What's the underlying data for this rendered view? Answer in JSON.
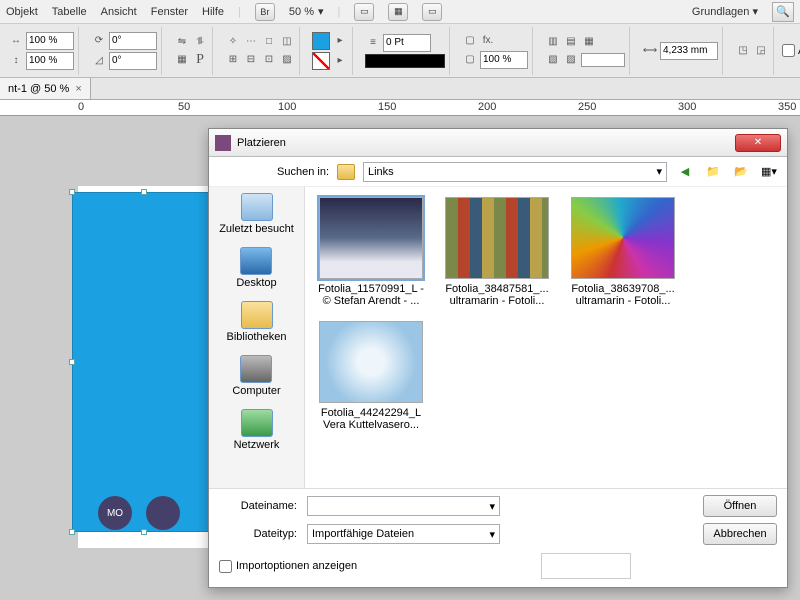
{
  "menu": {
    "objekt": "Objekt",
    "tabelle": "Tabelle",
    "ansicht": "Ansicht",
    "fenster": "Fenster",
    "hilfe": "Hilfe",
    "br": "Br",
    "zoom": "50 %",
    "grundlagen": "Grundlagen"
  },
  "toolbar": {
    "scale_x": "100 %",
    "scale_y": "100 %",
    "rot": "0°",
    "shear": "0°",
    "stroke": "0 Pt",
    "opacity": "100 %",
    "width": "4,233 mm",
    "auto_label": "Autom"
  },
  "doctab": {
    "title": "nt-1 @ 50 %"
  },
  "ruler": {
    "t0": "0",
    "t50": "50",
    "t100": "100",
    "t150": "150",
    "t200": "200",
    "t250": "250",
    "t300": "300",
    "t350": "350"
  },
  "canvas": {
    "circle1": "MO"
  },
  "dialog": {
    "title": "Platzieren",
    "search_in_label": "Suchen in:",
    "folder": "Links",
    "places": {
      "recent": "Zuletzt besucht",
      "desktop": "Desktop",
      "libs": "Bibliotheken",
      "computer": "Computer",
      "network": "Netzwerk"
    },
    "files": [
      {
        "n1": "Fotolia_11570991_L -",
        "n2": "© Stefan Arendt - ...",
        "cls": "t1",
        "sel": true
      },
      {
        "n1": "Fotolia_38487581_...",
        "n2": "ultramarin - Fotoli...",
        "cls": "t2"
      },
      {
        "n1": "Fotolia_38639708_...",
        "n2": "ultramarin - Fotoli...",
        "cls": "t3"
      },
      {
        "n1": "Fotolia_44242294_L",
        "n2": "Vera Kuttelvasero...",
        "cls": "t4"
      }
    ],
    "filename_label": "Dateiname:",
    "filetype_label": "Dateityp:",
    "filetype_value": "Importfähige Dateien",
    "open_btn": "Öffnen",
    "cancel_btn": "Abbrechen",
    "importopts": "Importoptionen anzeigen"
  }
}
